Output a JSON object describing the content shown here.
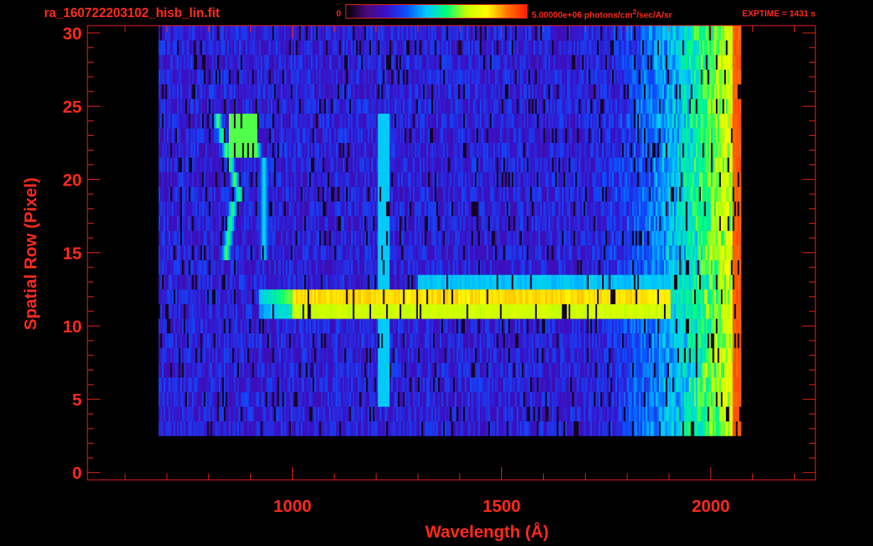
{
  "header": {
    "file_title": "ra_160722203102_hisb_lin.fit",
    "colorbar_min": "0",
    "colorbar_max_value": "5.00000e+06 photons/cm",
    "colorbar_unit_sup": "2",
    "colorbar_unit_rest": "/sec/A/sr",
    "exptime": "EXPTIME = 1431 s"
  },
  "colors": {
    "axis": "#ff2a1a",
    "background": "#000000",
    "colormap": [
      "#000000",
      "#4a0a78",
      "#3a10c8",
      "#0a50ff",
      "#00c8ff",
      "#00ff78",
      "#c8ff00",
      "#ffff00",
      "#ff7800",
      "#ff1e00"
    ]
  },
  "chart_data": {
    "type": "heatmap",
    "title": "ra_160722203102_hisb_lin.fit",
    "xlabel": "Wavelength (Å)",
    "ylabel": "Spatial Row (Pixel)",
    "xlim": [
      510,
      2250
    ],
    "ylim": [
      -0.5,
      30.5
    ],
    "x_ticks": [
      1000,
      1500,
      2000
    ],
    "y_ticks": [
      0,
      5,
      10,
      15,
      20,
      25,
      30
    ],
    "colorbar_range": [
      0,
      5000000
    ],
    "colormap": "rainbow",
    "data_x_range": [
      680,
      2070
    ],
    "data_rows": [
      3,
      30
    ],
    "features": [
      {
        "name": "bright spectral band",
        "rows": [
          11,
          12
        ],
        "x_range": [
          920,
          2070
        ],
        "relative_intensity": 0.8
      },
      {
        "name": "emission arc",
        "rows": [
          15,
          24
        ],
        "x_range": [
          780,
          950
        ],
        "relative_intensity": 0.6
      },
      {
        "name": "Lyman-alpha line",
        "rows": [
          5,
          24
        ],
        "x": 1216,
        "relative_intensity": 0.45
      },
      {
        "name": "long-wavelength edge",
        "rows": [
          3,
          30
        ],
        "x": 2060,
        "relative_intensity": 0.95
      }
    ]
  }
}
